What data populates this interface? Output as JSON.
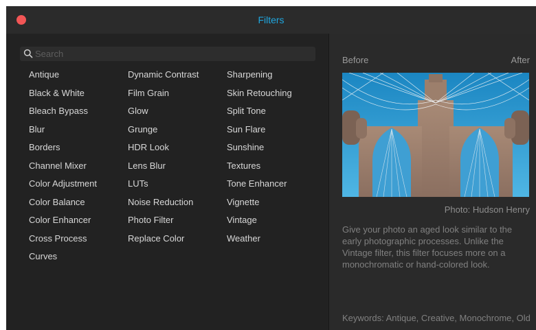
{
  "window": {
    "title": "Filters",
    "close_color": "#f25656",
    "accent": "#1fa7e0"
  },
  "search": {
    "placeholder": "Search",
    "value": ""
  },
  "filters": {
    "column1": [
      "Antique",
      "Black & White",
      "Bleach Bypass",
      "Blur",
      "Borders",
      "Channel Mixer",
      "Color Adjustment",
      "Color Balance",
      "Color Enhancer",
      "Cross Process",
      "Curves"
    ],
    "column2": [
      "Dynamic Contrast",
      "Film Grain",
      "Glow",
      "Grunge",
      "HDR Look",
      "Lens Blur",
      "LUTs",
      "Noise Reduction",
      "Photo Filter",
      "Replace Color"
    ],
    "column3": [
      "Sharpening",
      "Skin Retouching",
      "Split Tone",
      "Sun Flare",
      "Sunshine",
      "Textures",
      "Tone Enhancer",
      "Vignette",
      "Vintage",
      "Weather"
    ]
  },
  "preview": {
    "before_label": "Before",
    "after_label": "After",
    "credit": "Photo: Hudson Henry",
    "description": "Give your photo an aged look similar to the early photographic processes. Unlike the Vintage filter, this filter focuses more on a monochromatic or hand-colored look.",
    "keywords": "Keywords: Antique, Creative, Monochrome, Old"
  }
}
